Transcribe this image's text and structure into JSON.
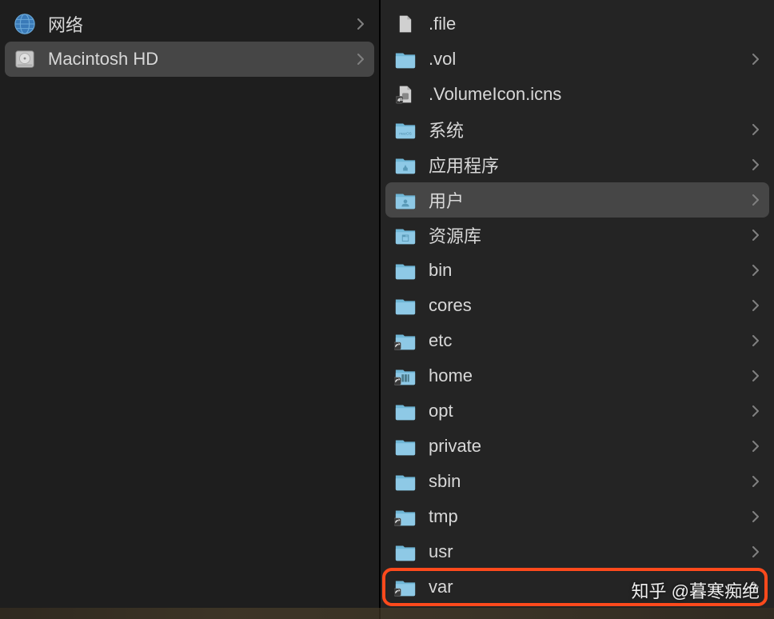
{
  "leftPane": {
    "items": [
      {
        "icon": "network",
        "label": "网络",
        "selected": false,
        "hasChevron": true
      },
      {
        "icon": "hdd",
        "label": "Macintosh HD",
        "selected": true,
        "hasChevron": true
      }
    ]
  },
  "rightPane": {
    "items": [
      {
        "icon": "file",
        "label": ".file",
        "selected": false,
        "hasChevron": false,
        "isAlias": false
      },
      {
        "icon": "folder",
        "label": ".vol",
        "selected": false,
        "hasChevron": true,
        "isAlias": false
      },
      {
        "icon": "icns",
        "label": ".VolumeIcon.icns",
        "selected": false,
        "hasChevron": false,
        "isAlias": true
      },
      {
        "icon": "folder-system",
        "label": "系统",
        "selected": false,
        "hasChevron": true,
        "isAlias": false
      },
      {
        "icon": "folder-apps",
        "label": "应用程序",
        "selected": false,
        "hasChevron": true,
        "isAlias": false
      },
      {
        "icon": "folder-users",
        "label": "用户",
        "selected": true,
        "hasChevron": true,
        "isAlias": false
      },
      {
        "icon": "folder-library",
        "label": "资源库",
        "selected": false,
        "hasChevron": true,
        "isAlias": false
      },
      {
        "icon": "folder",
        "label": "bin",
        "selected": false,
        "hasChevron": true,
        "isAlias": false
      },
      {
        "icon": "folder",
        "label": "cores",
        "selected": false,
        "hasChevron": true,
        "isAlias": false
      },
      {
        "icon": "folder",
        "label": "etc",
        "selected": false,
        "hasChevron": true,
        "isAlias": true
      },
      {
        "icon": "folder-home",
        "label": "home",
        "selected": false,
        "hasChevron": true,
        "isAlias": true
      },
      {
        "icon": "folder",
        "label": "opt",
        "selected": false,
        "hasChevron": true,
        "isAlias": false
      },
      {
        "icon": "folder",
        "label": "private",
        "selected": false,
        "hasChevron": true,
        "isAlias": false
      },
      {
        "icon": "folder",
        "label": "sbin",
        "selected": false,
        "hasChevron": true,
        "isAlias": false
      },
      {
        "icon": "folder",
        "label": "tmp",
        "selected": false,
        "hasChevron": true,
        "isAlias": true
      },
      {
        "icon": "folder",
        "label": "usr",
        "selected": false,
        "hasChevron": true,
        "isAlias": false
      },
      {
        "icon": "folder",
        "label": "var",
        "selected": false,
        "hasChevron": true,
        "isAlias": true
      }
    ]
  },
  "highlightIndex": 16,
  "watermark": "知乎 @暮寒痴绝"
}
